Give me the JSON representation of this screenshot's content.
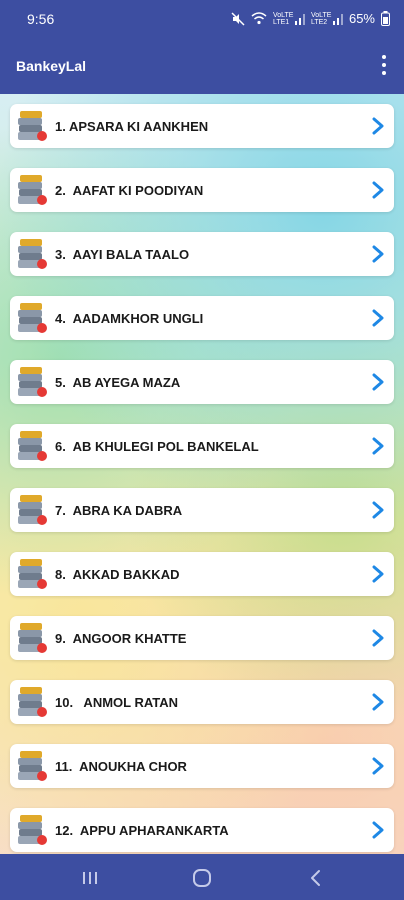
{
  "status_bar": {
    "time": "9:56",
    "signal_label": "VoLTE LTE1",
    "signal_label_2": "VoLTE LTE2",
    "battery": "65%"
  },
  "app_bar": {
    "title": "BankeyLal"
  },
  "list": [
    {
      "label": "1. APSARA KI AANKHEN"
    },
    {
      "label": "2.  AAFAT KI POODIYAN"
    },
    {
      "label": "3.  AAYI BALA TAALO"
    },
    {
      "label": "4.  AADAMKHOR UNGLI"
    },
    {
      "label": "5.  AB AYEGA MAZA"
    },
    {
      "label": "6.  AB KHULEGI POL BANKELAL"
    },
    {
      "label": "7.  ABRA KA DABRA"
    },
    {
      "label": "8.  AKKAD BAKKAD"
    },
    {
      "label": "9.  ANGOOR KHATTE"
    },
    {
      "label": "10.   ANMOL RATAN"
    },
    {
      "label": "11.  ANOUKHA CHOR"
    },
    {
      "label": "12.  APPU APHARANKARTA"
    }
  ],
  "colors": {
    "primary": "#3d4ea1",
    "chevron": "#1e88e5"
  }
}
